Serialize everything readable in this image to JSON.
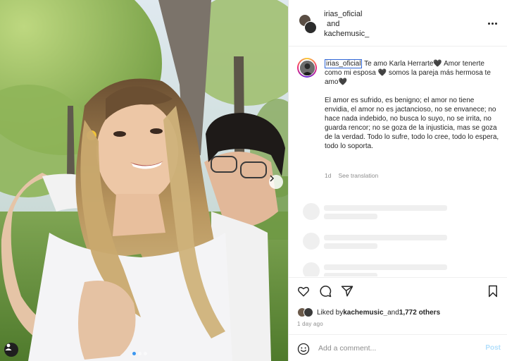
{
  "header": {
    "user1": "irias_oficial",
    "connector": "and",
    "user2": "kachemusic_"
  },
  "caption": {
    "username": "irias_oficial",
    "line1": " Te amo Karla Herrarte🖤 Amor tenerte como mi esposa 🖤 somos la pareja más hermosa te amo🖤",
    "paragraph": "El amor es sufrido, es benigno; el amor no tiene envidia, el amor no es jactancioso, no se envanece; no hace nada indebido, no busca lo suyo, no se irrita, no guarda rencor; no se goza de la injusticia, mas se goza de la verdad. Todo lo sufre, todo lo cree, todo lo espera, todo lo soporta.",
    "age": "1d",
    "translate": "See translation"
  },
  "likes": {
    "prefix": "Liked by ",
    "user": "kachemusic_",
    "middle": " and ",
    "count": "1,772 others"
  },
  "timestamp": "1 day ago",
  "comment": {
    "placeholder": "Add a comment...",
    "post_label": "Post"
  },
  "carousel": {
    "slides": 3,
    "active": 1
  },
  "icons": {
    "like": "heart-icon",
    "comment": "comment-icon",
    "share": "paper-plane-icon",
    "save": "bookmark-icon",
    "more": "more-dots-icon",
    "emoji": "emoji-icon",
    "tag": "user-tag-icon",
    "next": "chevron-right-icon"
  },
  "colors": {
    "link_blue": "#0095f6",
    "post_disabled": "#b2dffc",
    "muted": "#8e8e8e",
    "text": "#262626"
  }
}
